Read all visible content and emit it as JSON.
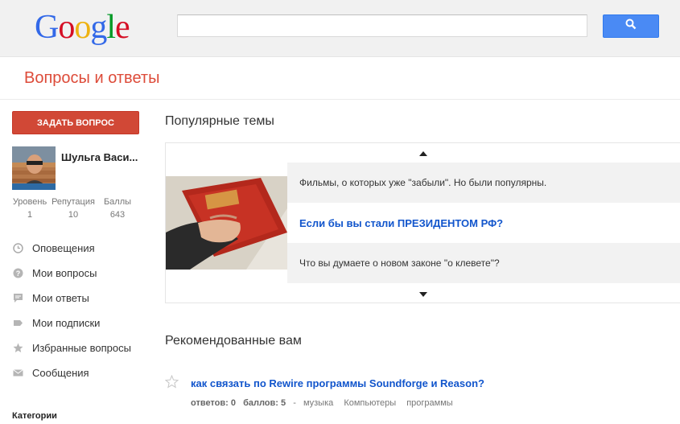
{
  "header": {
    "logo": [
      {
        "ch": "G",
        "color": "#3369e8"
      },
      {
        "ch": "o",
        "color": "#d50f25"
      },
      {
        "ch": "o",
        "color": "#eeb211"
      },
      {
        "ch": "g",
        "color": "#3369e8"
      },
      {
        "ch": "l",
        "color": "#009925"
      },
      {
        "ch": "e",
        "color": "#d50f25"
      }
    ],
    "search_value": "",
    "search_icon": "search-icon",
    "app_title": "Вопросы и ответы",
    "accent": "#dd4b39"
  },
  "sidebar": {
    "ask_button": "ЗАДАТЬ ВОПРОС",
    "user_name": "Шульга Васи...",
    "stats": [
      {
        "label": "Уровень",
        "value": "1"
      },
      {
        "label": "Репутация",
        "value": "10"
      },
      {
        "label": "Баллы",
        "value": "643"
      }
    ],
    "nav": [
      {
        "label": "Оповещения",
        "icon": "clock-icon"
      },
      {
        "label": "Мои вопросы",
        "icon": "question-icon"
      },
      {
        "label": "Мои ответы",
        "icon": "comment-icon"
      },
      {
        "label": "Мои подписки",
        "icon": "label-icon"
      },
      {
        "label": "Избранные вопросы",
        "icon": "star-icon"
      },
      {
        "label": "Сообщения",
        "icon": "mail-icon"
      }
    ],
    "categories_label": "Категории"
  },
  "main": {
    "popular_title": "Популярные темы",
    "topics": [
      {
        "text": "Фильмы, о которых уже \"забыли\". Но были популярны.",
        "highlight": false
      },
      {
        "text": "Если бы вы стали ПРЕЗИДЕНТОМ РФ?",
        "highlight": true
      },
      {
        "text": "Что вы думаете о новом законе \"о клевете\"?",
        "highlight": false
      }
    ],
    "recommended_title": "Рекомендованные вам",
    "recommended": [
      {
        "title": "как связать по Rewire программы Soundforge и Reason?",
        "answers_label": "ответов:",
        "answers": "0",
        "points_label": "баллов:",
        "points": "5",
        "separator": "-",
        "tags": [
          "музыка",
          "Компьютеры",
          "программы"
        ]
      }
    ]
  }
}
